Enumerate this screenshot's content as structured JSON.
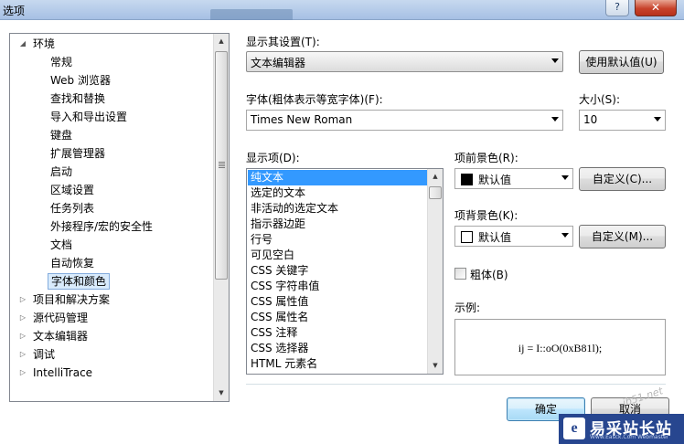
{
  "window": {
    "title": "选项",
    "close_label": "✕",
    "help_label": "?"
  },
  "tree": {
    "items": [
      {
        "label": "环境",
        "level": 0,
        "expanded": true
      },
      {
        "label": "常规",
        "level": 1
      },
      {
        "label": "Web 浏览器",
        "level": 1
      },
      {
        "label": "查找和替换",
        "level": 1
      },
      {
        "label": "导入和导出设置",
        "level": 1
      },
      {
        "label": "键盘",
        "level": 1
      },
      {
        "label": "扩展管理器",
        "level": 1
      },
      {
        "label": "启动",
        "level": 1
      },
      {
        "label": "区域设置",
        "level": 1
      },
      {
        "label": "任务列表",
        "level": 1
      },
      {
        "label": "外接程序/宏的安全性",
        "level": 1
      },
      {
        "label": "文档",
        "level": 1
      },
      {
        "label": "自动恢复",
        "level": 1
      },
      {
        "label": "字体和颜色",
        "level": 1,
        "selected": true
      },
      {
        "label": "项目和解决方案",
        "level": 0,
        "expanded": false
      },
      {
        "label": "源代码管理",
        "level": 0,
        "expanded": false
      },
      {
        "label": "文本编辑器",
        "level": 0,
        "expanded": false
      },
      {
        "label": "调试",
        "level": 0,
        "expanded": false
      },
      {
        "label": "IntelliTrace",
        "level": 0,
        "expanded": false
      }
    ]
  },
  "settings": {
    "show_settings_label": "显示其设置(T):",
    "show_settings_value": "文本编辑器",
    "use_defaults_button": "使用默认值(U)",
    "font_label": "字体(粗体表示等宽字体)(F):",
    "font_value": "Times New Roman",
    "size_label": "大小(S):",
    "size_value": "10",
    "display_items_label": "显示项(D):",
    "display_items": [
      "纯文本",
      "选定的文本",
      "非活动的选定文本",
      "指示器边距",
      "行号",
      "可见空白",
      "CSS 关键字",
      "CSS 字符串值",
      "CSS 属性值",
      "CSS 属性名",
      "CSS 注释",
      "CSS 选择器",
      "HTML 元素名"
    ],
    "foreground_label": "项前景色(R):",
    "foreground_value": "默认值",
    "foreground_custom_button": "自定义(C)...",
    "background_label": "项背景色(K):",
    "background_value": "默认值",
    "background_custom_button": "自定义(M)...",
    "bold_label": "粗体(B)",
    "sample_label": "示例:",
    "sample_text": "ij = I::oO(0xB81l);"
  },
  "colors": {
    "foreground_swatch": "#000000",
    "background_swatch": "#ffffff",
    "selection": "#3399ff"
  },
  "footer": {
    "ok_button": "确定",
    "cancel_button": "取消"
  },
  "watermark": {
    "name": "易采站长站",
    "sub": "Www.Easck.Com Webmaster",
    "diag": "jb51.net"
  }
}
